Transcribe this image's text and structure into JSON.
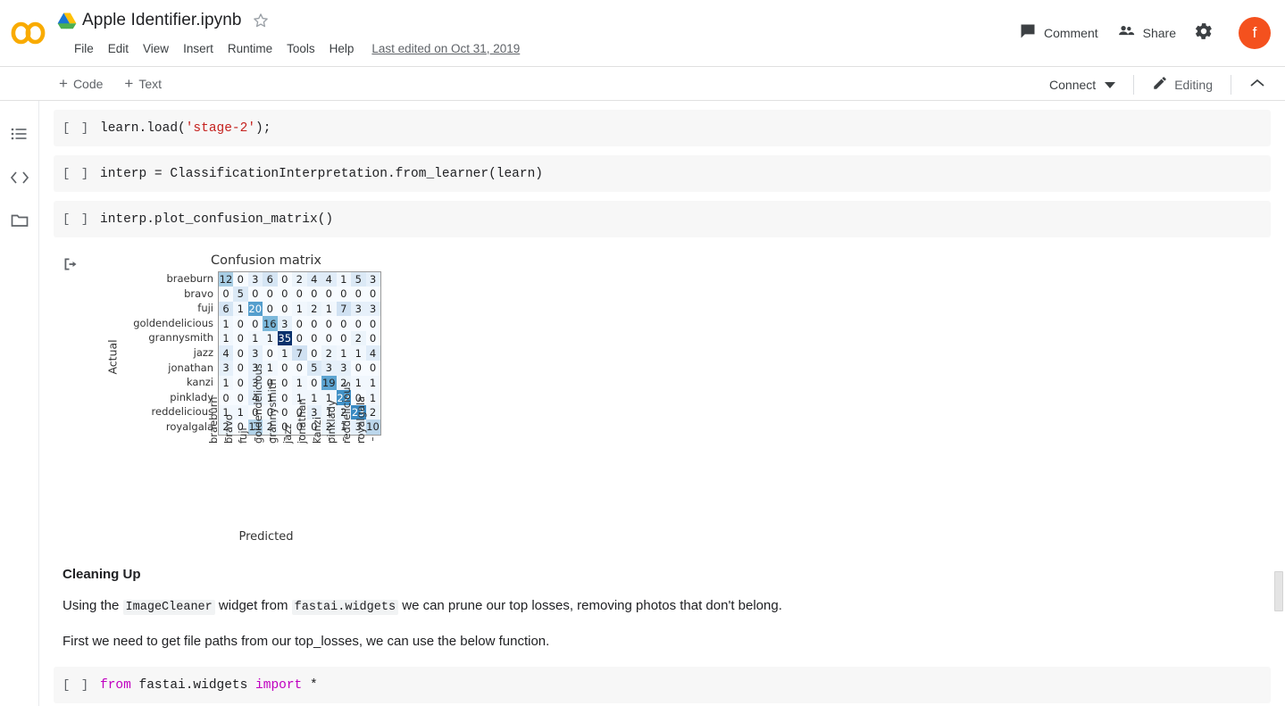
{
  "app": {
    "logo": "colab-logo",
    "drive_icon": "google-drive-icon",
    "doc_title": "Apple Identifier.ipynb",
    "star_icon": "star-icon",
    "last_edited": "Last edited on Oct 31, 2019",
    "avatar_initial": "f",
    "avatar_color": "#f4511e"
  },
  "menu": {
    "items": [
      "File",
      "Edit",
      "View",
      "Insert",
      "Runtime",
      "Tools",
      "Help"
    ]
  },
  "header_actions": {
    "comment": "Comment",
    "share": "Share",
    "settings_icon": "gear-icon"
  },
  "toolbar": {
    "add_code": "Code",
    "add_text": "Text",
    "connect": "Connect",
    "connect_caret": "caret-down-icon",
    "editing": "Editing",
    "editing_icon": "pencil-icon",
    "collapse_icon": "chevron-up-icon"
  },
  "left_rail": {
    "items": [
      {
        "name": "table-of-contents-icon"
      },
      {
        "name": "code-snippets-icon"
      },
      {
        "name": "files-icon"
      }
    ]
  },
  "cells": [
    {
      "gutter": "[ ]",
      "segments": [
        {
          "t": "learn.load(",
          "c": "plain"
        },
        {
          "t": "'stage-2'",
          "c": "str"
        },
        {
          "t": ");",
          "c": "plain"
        }
      ]
    },
    {
      "gutter": "[ ]",
      "segments": [
        {
          "t": "interp = ClassificationInterpretation.from_learner(learn)",
          "c": "plain"
        }
      ]
    },
    {
      "gutter": "[ ]",
      "segments": [
        {
          "t": "interp.plot_confusion_matrix()",
          "c": "plain"
        }
      ]
    }
  ],
  "output": {
    "marker_icon": "output-arrow-icon"
  },
  "chart_data": {
    "type": "heatmap",
    "title": "Confusion matrix",
    "xlabel": "Predicted",
    "ylabel": "Actual",
    "grid": true,
    "colormap": "Blues",
    "vmin": 0,
    "vmax": 35,
    "categories": [
      "braeburn",
      "bravo",
      "fuji",
      "goldendelicious",
      "grannysmith",
      "jazz",
      "jonathan",
      "kanzi",
      "pinklady",
      "reddelicious",
      "royalgala"
    ],
    "row_labels": [
      "braeburn",
      "bravo",
      "fuji",
      "goldendelicious",
      "grannysmith",
      "jazz",
      "jonathan",
      "kanzi",
      "pinklady",
      "reddelicious",
      "royalgala"
    ],
    "col_labels": [
      "braeburn",
      "bravo",
      "fuji",
      "goldendelicious",
      "grannysmith",
      "jazz",
      "jonathan",
      "kanzi",
      "pinklady",
      "reddelicious",
      "royalgala"
    ],
    "values": [
      [
        12,
        0,
        3,
        6,
        0,
        2,
        4,
        4,
        1,
        5,
        3
      ],
      [
        0,
        5,
        0,
        0,
        0,
        0,
        0,
        0,
        0,
        0,
        0
      ],
      [
        6,
        1,
        20,
        0,
        0,
        1,
        2,
        1,
        7,
        3,
        3
      ],
      [
        1,
        0,
        0,
        16,
        3,
        0,
        0,
        0,
        0,
        0,
        0
      ],
      [
        1,
        0,
        1,
        1,
        35,
        0,
        0,
        0,
        0,
        2,
        0
      ],
      [
        4,
        0,
        3,
        0,
        1,
        7,
        0,
        2,
        1,
        1,
        4
      ],
      [
        3,
        0,
        3,
        1,
        0,
        0,
        5,
        3,
        3,
        0,
        0
      ],
      [
        1,
        0,
        3,
        0,
        0,
        1,
        0,
        19,
        2,
        1,
        1
      ],
      [
        0,
        0,
        4,
        1,
        0,
        1,
        1,
        1,
        22,
        0,
        1
      ],
      [
        1,
        1,
        0,
        0,
        0,
        0,
        3,
        1,
        2,
        23,
        2
      ],
      [
        2,
        0,
        11,
        2,
        0,
        0,
        0,
        2,
        1,
        3,
        10
      ]
    ]
  },
  "markdown": {
    "heading": "Cleaning Up",
    "p1_a": "Using the ",
    "p1_code1": "ImageCleaner",
    "p1_b": " widget from ",
    "p1_code2": "fastai.widgets",
    "p1_c": " we can prune our top losses, removing photos that don't belong.",
    "p2": "First we need to get file paths from our top_losses, we can use the below function."
  },
  "last_cell": {
    "gutter": "[ ]",
    "segments": [
      {
        "t": "from ",
        "c": "kw"
      },
      {
        "t": "fastai.widgets ",
        "c": "plain"
      },
      {
        "t": "import ",
        "c": "kw"
      },
      {
        "t": "*",
        "c": "plain"
      }
    ]
  }
}
